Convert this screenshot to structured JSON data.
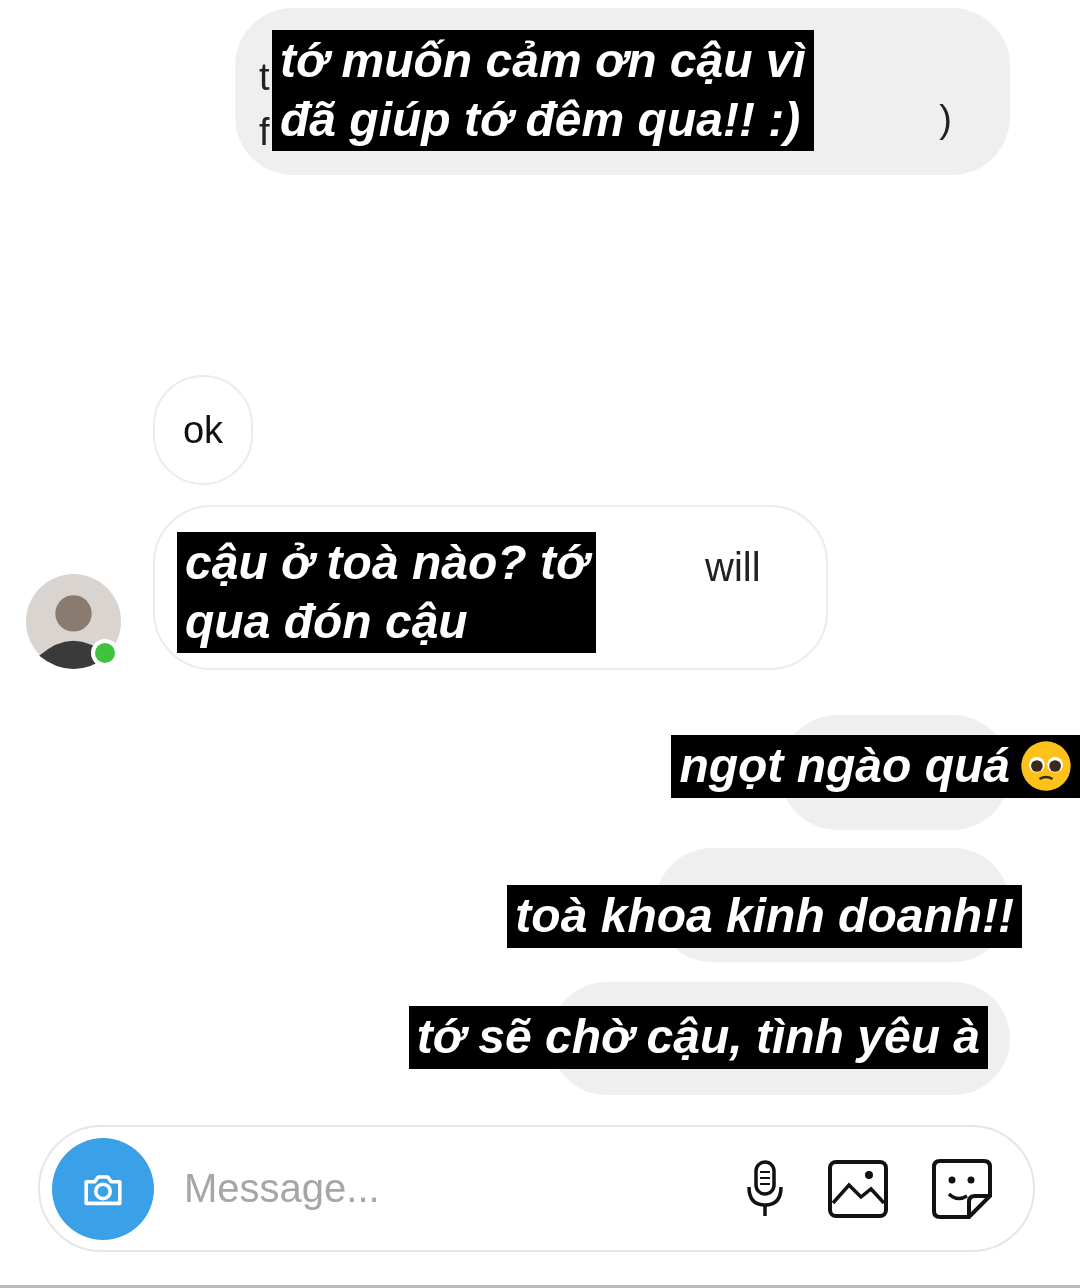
{
  "messages": [
    {
      "kind": "outgoing",
      "caption": [
        "tớ muốn cảm ơn cậu vì",
        "đã giúp tớ đêm qua!! :)"
      ],
      "peek_left": [
        "t",
        "f"
      ],
      "peek_right": ")"
    },
    {
      "kind": "incoming",
      "text": "ok"
    },
    {
      "kind": "incoming",
      "caption": [
        "cậu ở toà nào? tớ",
        "qua đón cậu"
      ],
      "peek_right": "will",
      "avatar": true,
      "online": true
    },
    {
      "kind": "outgoing",
      "caption": [
        "ngọt ngào quá"
      ],
      "emoji": true
    },
    {
      "kind": "outgoing",
      "caption": [
        "toà khoa kinh doanh!!"
      ]
    },
    {
      "kind": "outgoing",
      "caption": [
        "tớ sẽ chờ cậu, tình yêu à"
      ]
    }
  ],
  "composer": {
    "placeholder": "Message..."
  }
}
